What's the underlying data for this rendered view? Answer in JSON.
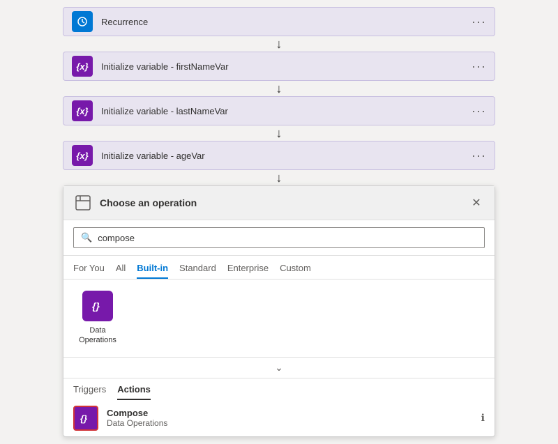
{
  "flow": {
    "steps": [
      {
        "id": "recurrence",
        "label": "Recurrence",
        "icon_type": "blue",
        "icon": "clock"
      },
      {
        "id": "init-firstname",
        "label": "Initialize variable - firstNameVar",
        "icon_type": "purple",
        "icon": "var"
      },
      {
        "id": "init-lastname",
        "label": "Initialize variable - lastNameVar",
        "icon_type": "purple",
        "icon": "var"
      },
      {
        "id": "init-age",
        "label": "Initialize variable - ageVar",
        "icon_type": "purple",
        "icon": "var"
      }
    ]
  },
  "panel": {
    "title": "Choose an operation",
    "search_placeholder": "compose",
    "tabs": [
      {
        "id": "for-you",
        "label": "For You",
        "active": false
      },
      {
        "id": "all",
        "label": "All",
        "active": false
      },
      {
        "id": "built-in",
        "label": "Built-in",
        "active": true
      },
      {
        "id": "standard",
        "label": "Standard",
        "active": false
      },
      {
        "id": "enterprise",
        "label": "Enterprise",
        "active": false
      },
      {
        "id": "custom",
        "label": "Custom",
        "active": false
      }
    ],
    "operations": [
      {
        "id": "data-operations",
        "label": "Data\nOperations",
        "icon_type": "purple"
      }
    ],
    "sub_tabs": [
      {
        "id": "triggers",
        "label": "Triggers",
        "active": false
      },
      {
        "id": "actions",
        "label": "Actions",
        "active": true
      }
    ],
    "compose_item": {
      "title": "Compose",
      "subtitle": "Data Operations"
    }
  }
}
